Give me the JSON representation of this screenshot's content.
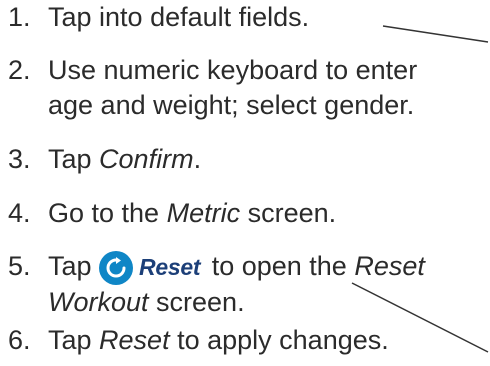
{
  "steps": [
    {
      "num": "1.",
      "text": "Tap into default fields."
    },
    {
      "num": "2.",
      "line1": "Use numeric keyboard to enter",
      "line2": "age and weight; select gender."
    },
    {
      "num": "3.",
      "pre": "Tap ",
      "em": "Confirm",
      "post": "."
    },
    {
      "num": "4.",
      "pre": "Go to the ",
      "em": "Metric",
      "post": " screen."
    },
    {
      "num": "5.",
      "pre": "Tap ",
      "button_label": "Reset",
      "mid": " to open the ",
      "em1": "Reset",
      "em2": "Workout",
      "post": " screen."
    },
    {
      "num": "6.",
      "pre": "Tap ",
      "em": "Reset",
      "post": " to apply changes."
    }
  ],
  "icons": {
    "reset_button_icon": "refresh-icon"
  },
  "colors": {
    "text": "#2b2b2b",
    "icon_bg": "#0f86c6",
    "button_label": "#1c3f78"
  }
}
